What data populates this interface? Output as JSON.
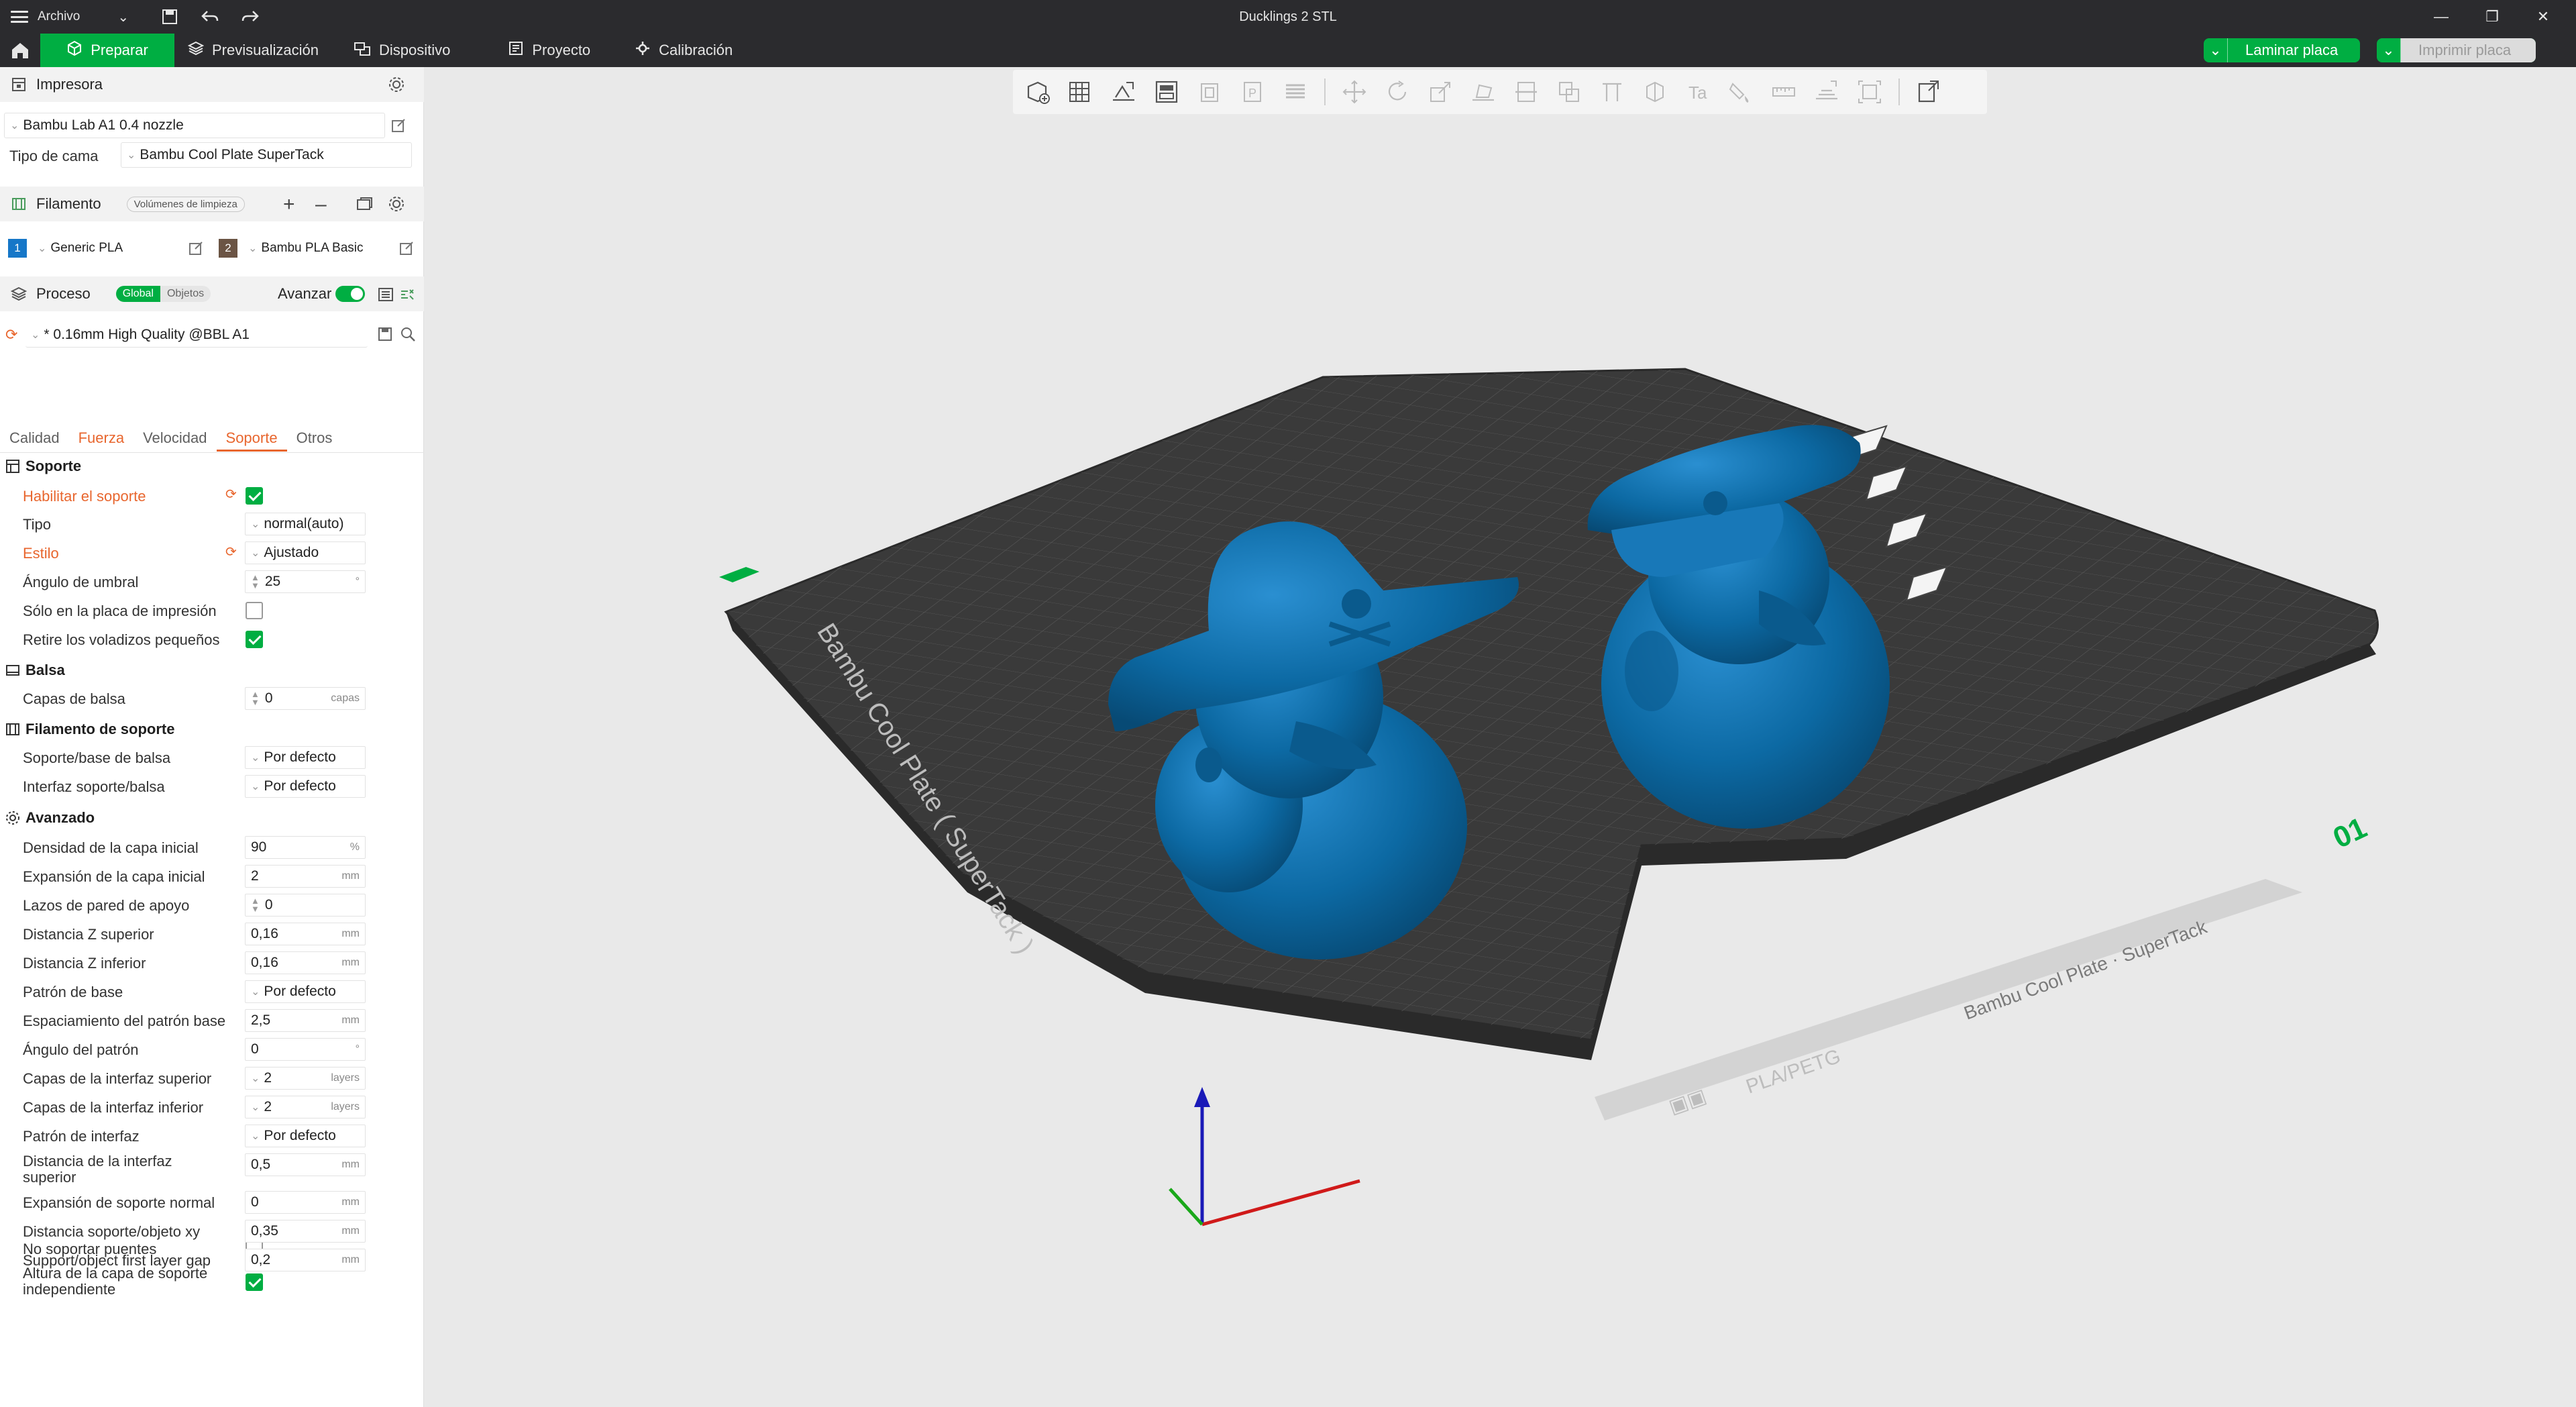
{
  "titlebar": {
    "file_menu": "Archivo",
    "window_title": "Ducklings 2 STL"
  },
  "toolbar": {
    "tabs": [
      {
        "label": "Preparar",
        "icon": "cube-icon"
      },
      {
        "label": "Previsualización",
        "icon": "layers-icon"
      },
      {
        "label": "Dispositivo",
        "icon": "device-icon"
      },
      {
        "label": "Proyecto",
        "icon": "project-icon"
      },
      {
        "label": "Calibración",
        "icon": "calibration-icon"
      }
    ],
    "slice_label": "Laminar placa",
    "print_label": "Imprimir placa"
  },
  "printer": {
    "section_title": "Impresora",
    "printer_name": "Bambu Lab A1 0.4 nozzle",
    "bed_type_label": "Tipo de cama",
    "bed_type_value": "Bambu Cool Plate SuperTack"
  },
  "filament": {
    "section_title": "Filamento",
    "flush_button": "Volúmenes de limpieza",
    "slots": [
      {
        "index": "1",
        "name": "Generic PLA",
        "color": "#1677c8"
      },
      {
        "index": "2",
        "name": "Bambu PLA Basic",
        "color": "#6b5444"
      }
    ]
  },
  "process": {
    "section_title": "Proceso",
    "toggle_global": "Global",
    "toggle_objects": "Objetos",
    "advanced_label": "Avanzar",
    "preset_name": "* 0.16mm High Quality @BBL A1",
    "subtabs": [
      "Calidad",
      "Fuerza",
      "Velocidad",
      "Soporte",
      "Otros"
    ],
    "active_subtab": "Soporte"
  },
  "support": {
    "group_soporte": "Soporte",
    "enable_label": "Habilitar el soporte",
    "type_label": "Tipo",
    "type_value": "normal(auto)",
    "style_label": "Estilo",
    "style_value": "Ajustado",
    "threshold_label": "Ángulo de umbral",
    "threshold_value": "25",
    "threshold_unit": "°",
    "only_plate_label": "Sólo en la placa de impresión",
    "remove_small_label": "Retire los voladizos pequeños",
    "group_balsa": "Balsa",
    "raft_layers_label": "Capas de balsa",
    "raft_layers_value": "0",
    "raft_layers_unit": "capas",
    "group_filament": "Filamento de soporte",
    "base_filament_label": "Soporte/base de balsa",
    "base_filament_value": "Por defecto",
    "interface_filament_label": "Interfaz soporte/balsa",
    "interface_filament_value": "Por defecto",
    "group_advanced": "Avanzado",
    "advanced_rows": [
      {
        "label": "Densidad de la capa inicial",
        "value": "90",
        "unit": "%",
        "kind": "num"
      },
      {
        "label": "Expansión de la capa inicial",
        "value": "2",
        "unit": "mm",
        "kind": "num"
      },
      {
        "label": "Lazos de pared de apoyo",
        "value": "0",
        "unit": "",
        "kind": "spin"
      },
      {
        "label": "Distancia Z superior",
        "value": "0,16",
        "unit": "mm",
        "kind": "num"
      },
      {
        "label": "Distancia Z inferior",
        "value": "0,16",
        "unit": "mm",
        "kind": "num"
      },
      {
        "label": "Patrón de base",
        "value": "Por defecto",
        "unit": "",
        "kind": "dd"
      },
      {
        "label": "Espaciamiento del patrón base",
        "value": "2,5",
        "unit": "mm",
        "kind": "num"
      },
      {
        "label": "Ángulo del patrón",
        "value": "0",
        "unit": "°",
        "kind": "num"
      },
      {
        "label": "Capas de la interfaz superior",
        "value": "2",
        "unit": "layers",
        "kind": "dd"
      },
      {
        "label": "Capas de la interfaz inferior",
        "value": "2",
        "unit": "layers",
        "kind": "dd"
      },
      {
        "label": "Patrón de interfaz",
        "value": "Por defecto",
        "unit": "",
        "kind": "dd"
      },
      {
        "label": "Distancia de la interfaz superior",
        "value": "0,5",
        "unit": "mm",
        "kind": "num"
      },
      {
        "label": "Expansión de soporte normal",
        "value": "0",
        "unit": "mm",
        "kind": "num"
      },
      {
        "label": "Distancia soporte/objeto xy",
        "value": "0,35",
        "unit": "mm",
        "kind": "num"
      },
      {
        "label": "Support/object first layer gap",
        "value": "0,2",
        "unit": "mm",
        "kind": "num"
      }
    ],
    "no_bridge_label": "No soportar puentes",
    "independent_height_label": "Altura de la capa de soporte independiente"
  },
  "viewport": {
    "plate_label": "Bambu Cool Plate ( SuperTack )",
    "plate_front_label": "Bambu Cool Plate · SuperTack",
    "plate_material": "PLA/PETG",
    "plate_number": "01",
    "model_color": "#0c69a3",
    "plate_color": "#3a3a3a"
  },
  "colors": {
    "accent": "#00ae42",
    "modified": "#e8662e",
    "dark_bar": "#2b2b2e"
  }
}
